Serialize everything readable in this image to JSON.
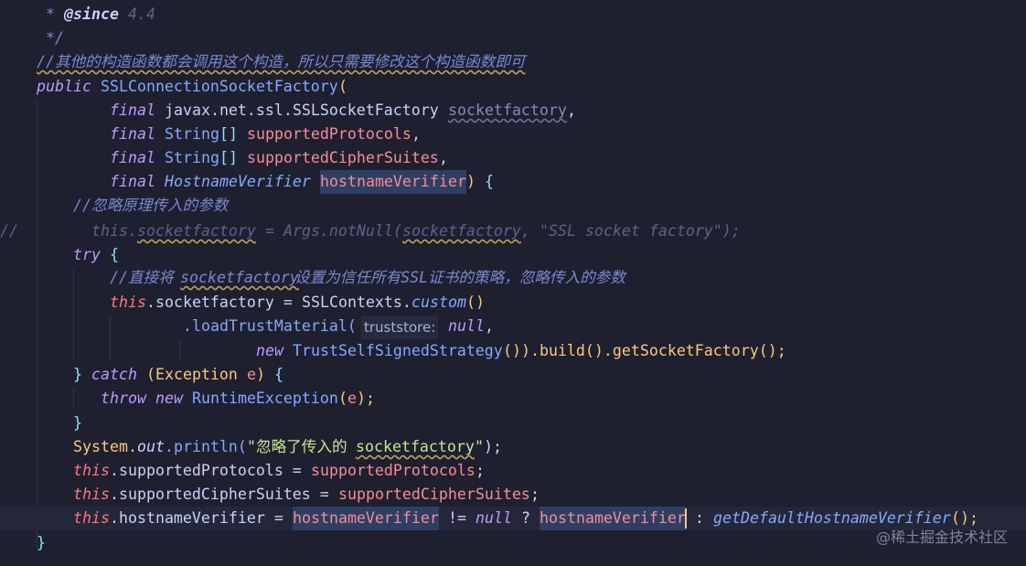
{
  "code": {
    "l1_star": " * ",
    "l1_tag": "@since",
    "l1_ver": " 4.4",
    "l2": " */",
    "l3_comment": "//其他的构造函数都会调用这个构造，所以只需要修改这个构造函数即可",
    "l4_public": "public",
    "l4_ctor": "SSLConnectionSocketFactory",
    "l4_paren": "(",
    "l5_final": "final",
    "l5_type": "javax.net.ssl.SSLSocketFactory",
    "l5_param": "socketfactory",
    "l5_comma": ",",
    "l6_final": "final",
    "l6_type": "String",
    "l6_brackets": "[]",
    "l6_param": "supportedProtocols",
    "l6_comma": ",",
    "l7_final": "final",
    "l7_type": "String",
    "l7_brackets": "[]",
    "l7_param": "supportedCipherSuites",
    "l7_comma": ",",
    "l8_final": "final",
    "l8_type": "HostnameVerifier",
    "l8_param": "hostnameVerifier",
    "l8_close": ")",
    "l8_brace": "{",
    "l9_comment": "//忽略原理传入的参数",
    "l10_slashes": "//",
    "l10_code_a": "this.",
    "l10_code_b": "socketfactory",
    "l10_code_c": " = Args.notNull(",
    "l10_code_d": "socketfactory",
    "l10_code_e": ", \"SSL socket factory\");",
    "l11_try": "try",
    "l11_brace": "{",
    "l12_comment_a": "//直接将",
    "l12_comment_b": "socketfactory",
    "l12_comment_c": "设置为信任所有SSL证书的策略，忽略传入的参数",
    "l13_this": "this",
    "l13_field": ".socketfactory = ",
    "l13_cls": "SSLContexts.",
    "l13_custom": "custom",
    "l13_parens": "()",
    "l14_method": ".loadTrustMaterial(",
    "l14_hint": "truststore:",
    "l14_null": "null",
    "l14_comma": ",",
    "l15_new": "new",
    "l15_cls": "TrustSelfSignedStrategy",
    "l15_rest": "()).build().getSocketFactory();",
    "l16_brace": "}",
    "l16_catch": "catch",
    "l16_open": "(",
    "l16_type": "Exception",
    "l16_var": "e",
    "l16_close": ")",
    "l16_brace2": "{",
    "l17_throw": "throw",
    "l17_new": "new",
    "l17_cls": "RuntimeException",
    "l17_open": "(",
    "l17_e": "e",
    "l17_close": ");",
    "l18_brace": "}",
    "l19_sys": "System.",
    "l19_out": "out",
    "l19_println": ".println(",
    "l19_str_a": "\"忽略了传入的",
    "l19_str_b": "socketfactory",
    "l19_str_c": "\"",
    "l19_end": ");",
    "l20_this": "this",
    "l20_field": ".supportedProtocols = ",
    "l20_param": "supportedProtocols",
    "l20_end": ";",
    "l21_this": "this",
    "l21_field": ".supportedCipherSuites = ",
    "l21_param": "supportedCipherSuites",
    "l21_end": ";",
    "l22_this": "this",
    "l22_field": ".hostnameVerifier = ",
    "l22_param1": "hostnameVerifier",
    "l22_neq": " != ",
    "l22_null": "null",
    "l22_q": " ? ",
    "l22_param2": "hostnameVerifier",
    "l22_colon": " : ",
    "l22_fn": "getDefaultHostnameVerifier",
    "l22_end": "();",
    "l23_brace": "}"
  },
  "watermark": "@稀土掘金技术社区",
  "colors": {
    "background": "#1e2030",
    "current_line": "#24273a",
    "keyword": "#c099ff",
    "type": "#82aaff",
    "parameter": "#fc8a95",
    "comment": "#7a88cf",
    "string": "#c3e88d",
    "caret": "#ffc777"
  }
}
